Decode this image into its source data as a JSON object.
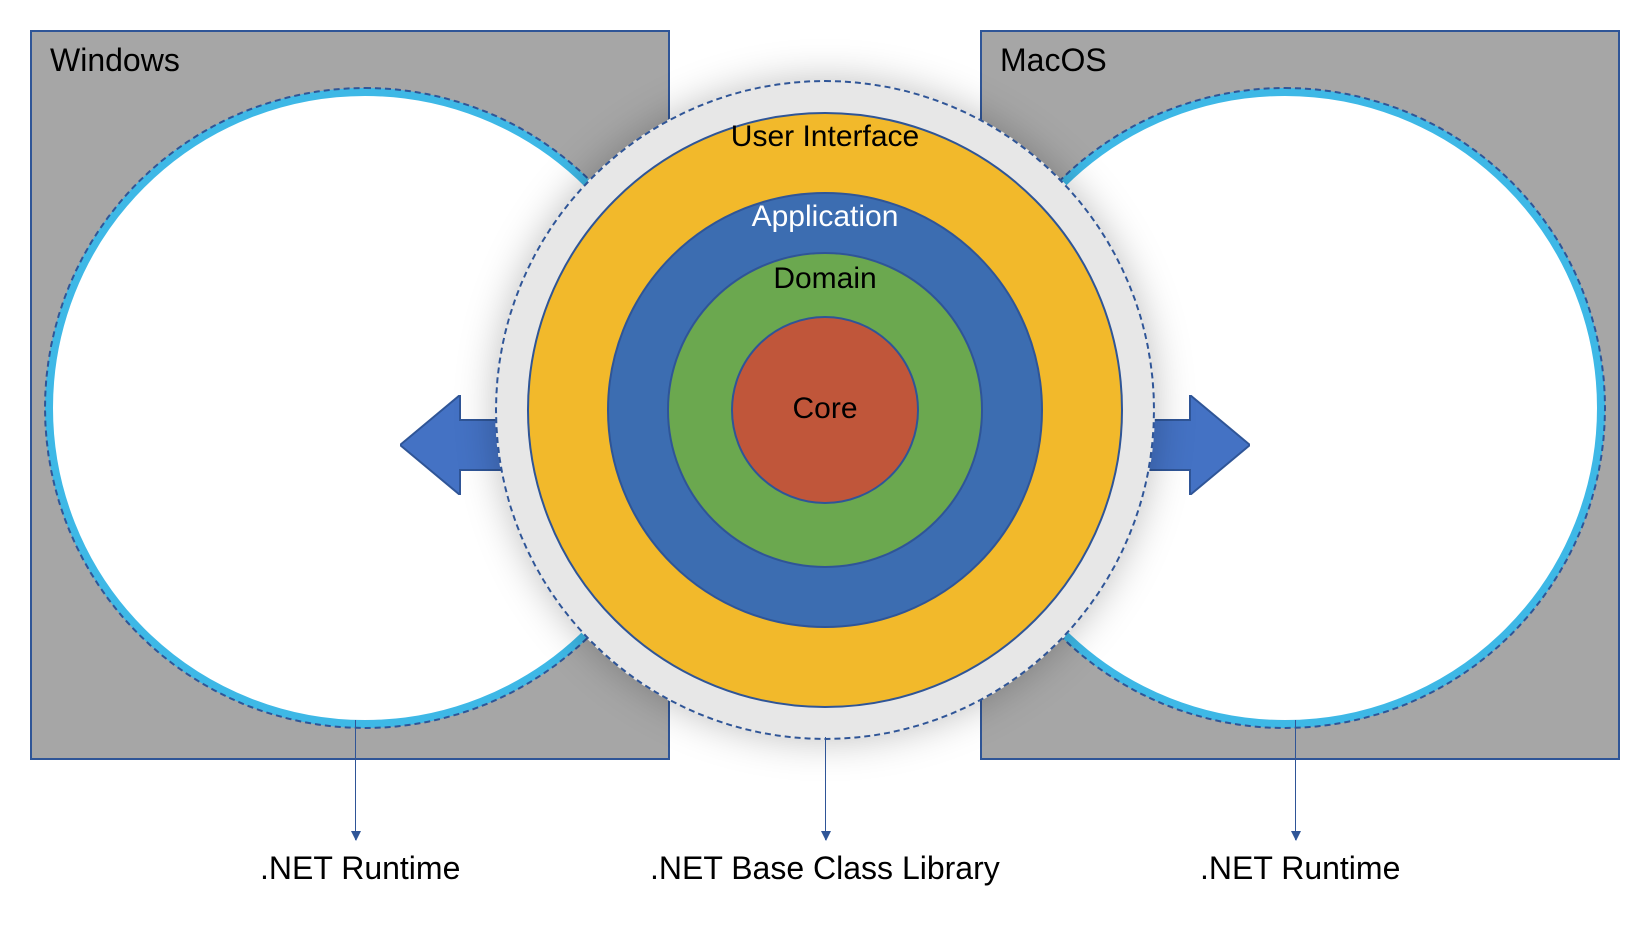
{
  "platforms": {
    "left": {
      "label": "Windows"
    },
    "right": {
      "label": "MacOS"
    }
  },
  "layers": {
    "bcl": ".NET Base Class Library",
    "ui": "User Interface",
    "application": "Application",
    "domain": "Domain",
    "core": "Core"
  },
  "callouts": {
    "left": ".NET Runtime",
    "center": ".NET Base Class Library",
    "right": ".NET Runtime"
  },
  "colors": {
    "box_bg": "#a6a6a6",
    "box_border": "#2f5597",
    "runtime_border": "#3eb8e6",
    "bcl": "#e7e7e7",
    "ui": "#f2b92b",
    "application": "#3c6db1",
    "domain": "#6ba84f",
    "core": "#c0563a",
    "arrow": "#4472c4"
  }
}
